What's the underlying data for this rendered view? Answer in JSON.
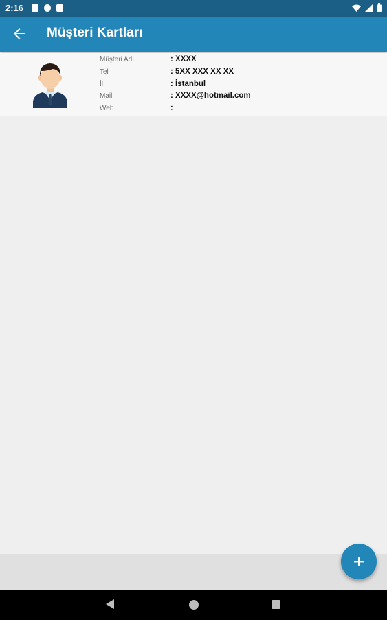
{
  "status_bar": {
    "time": "2:16"
  },
  "app_bar": {
    "title": "Müşteri Kartları"
  },
  "customer": {
    "fields": [
      {
        "label": "Müşteri Adı",
        "value": ": XXXX"
      },
      {
        "label": "Tel",
        "value": ": 5XX XXX XX XX"
      },
      {
        "label": "İl",
        "value": ": İstanbul"
      },
      {
        "label": "Mail",
        "value": ": XXXX@hotmail.com"
      },
      {
        "label": "Web",
        "value": ":"
      }
    ]
  },
  "colors": {
    "primary": "#2386b9",
    "status_bar": "#1b5f86",
    "background": "#efefef"
  },
  "icons": {
    "back": "arrow-left-icon",
    "fab": "plus-icon",
    "avatar": "businessman-avatar"
  }
}
